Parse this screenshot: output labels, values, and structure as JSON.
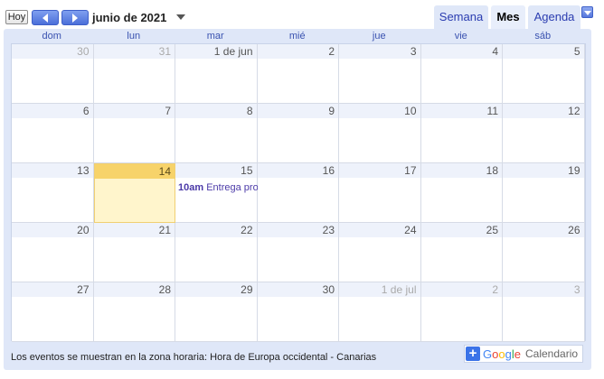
{
  "toolbar": {
    "today_label": "Hoy",
    "prev_icon": "chevron-left-icon",
    "next_icon": "chevron-right-icon",
    "current_period": "junio de 2021"
  },
  "tabs": [
    {
      "label": "Semana",
      "selected": false
    },
    {
      "label": "Mes",
      "selected": true
    },
    {
      "label": "Agenda",
      "selected": false
    }
  ],
  "weekdays": [
    "dom",
    "lun",
    "mar",
    "mié",
    "jue",
    "vie",
    "sáb"
  ],
  "weeks": [
    [
      {
        "label": "30",
        "other": true
      },
      {
        "label": "31",
        "other": true
      },
      {
        "label": "1 de jun"
      },
      {
        "label": "2"
      },
      {
        "label": "3"
      },
      {
        "label": "4"
      },
      {
        "label": "5"
      }
    ],
    [
      {
        "label": "6"
      },
      {
        "label": "7"
      },
      {
        "label": "8"
      },
      {
        "label": "9"
      },
      {
        "label": "10"
      },
      {
        "label": "11"
      },
      {
        "label": "12"
      }
    ],
    [
      {
        "label": "13"
      },
      {
        "label": "14",
        "today": true
      },
      {
        "label": "15",
        "event": {
          "time": "10am",
          "title": "Entrega proyecto"
        }
      },
      {
        "label": "16"
      },
      {
        "label": "17"
      },
      {
        "label": "18"
      },
      {
        "label": "19"
      }
    ],
    [
      {
        "label": "20"
      },
      {
        "label": "21"
      },
      {
        "label": "22"
      },
      {
        "label": "23"
      },
      {
        "label": "24"
      },
      {
        "label": "25"
      },
      {
        "label": "26"
      }
    ],
    [
      {
        "label": "27"
      },
      {
        "label": "28"
      },
      {
        "label": "29"
      },
      {
        "label": "30"
      },
      {
        "label": "1 de jul",
        "other": true
      },
      {
        "label": "2",
        "other": true
      },
      {
        "label": "3",
        "other": true
      }
    ]
  ],
  "footer": {
    "timezone_text": "Los eventos se muestran en la zona horaria: Hora de Europa occidental - Canarias",
    "badge_google": "Google",
    "badge_calendar": "Calendario"
  },
  "colors": {
    "accent": "#3b73e8",
    "today_bg": "#fff5cc",
    "today_bar": "#f7d36a",
    "event_text": "#4b3aa8"
  }
}
